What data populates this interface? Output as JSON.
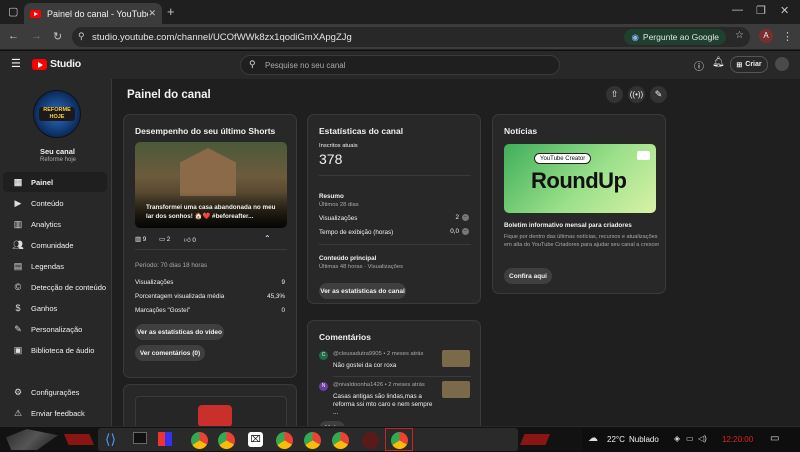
{
  "browser": {
    "tab_title": "Painel do canal - YouTube Studio",
    "url": "studio.youtube.com/channel/UCOfWWk8zx1qodiGmXApgZJg",
    "google_button": "Pergunte ao Google",
    "profile_letter": "A"
  },
  "header": {
    "logo_text": "Studio",
    "search_placeholder": "Pesquise no seu canal",
    "create_label": "Criar"
  },
  "sidebar": {
    "avatar_text": "REFORME HOJE",
    "channel_title": "Seu canal",
    "channel_name": "Reforme hoje",
    "items": [
      {
        "label": "Painel",
        "icon": "dashboard-icon"
      },
      {
        "label": "Conteúdo",
        "icon": "content-icon"
      },
      {
        "label": "Analytics",
        "icon": "analytics-icon"
      },
      {
        "label": "Comunidade",
        "icon": "community-icon"
      },
      {
        "label": "Legendas",
        "icon": "subtitles-icon"
      },
      {
        "label": "Detecção de conteúdo",
        "icon": "copyright-icon"
      },
      {
        "label": "Ganhos",
        "icon": "earn-icon"
      },
      {
        "label": "Personalização",
        "icon": "customization-icon"
      },
      {
        "label": "Biblioteca de áudio",
        "icon": "audio-library-icon"
      }
    ],
    "bottom_items": [
      {
        "label": "Configurações",
        "icon": "settings-icon"
      },
      {
        "label": "Enviar feedback",
        "icon": "feedback-icon"
      }
    ]
  },
  "page": {
    "title": "Painel do canal"
  },
  "shorts_card": {
    "title": "Desempenho do seu último Shorts",
    "video_title": "Transformei uma casa abandonada no meu lar dos sonhos! 🏠❤️ #beforeafter...",
    "views": "9",
    "comments": "2",
    "likes": "0",
    "dislikes": "0",
    "period": "Período: 70 dias 18 horas",
    "metrics": [
      {
        "label": "Visualizações",
        "value": "9"
      },
      {
        "label": "Porcentagem visualizada média",
        "value": "45,3%"
      },
      {
        "label": "Marcações \"Gostei\"",
        "value": "0"
      }
    ],
    "btn_stats": "Ver as estatísticas do vídeo",
    "btn_comments": "Ver comentários (0)"
  },
  "stats_card": {
    "title": "Estatísticas do canal",
    "subs_label": "Inscritos atuais",
    "subs_value": "378",
    "summary_title": "Resumo",
    "summary_period": "Últimos 28 dias",
    "rows": [
      {
        "label": "Visualizações",
        "value": "2"
      },
      {
        "label": "Tempo de exibição (horas)",
        "value": "0,0"
      }
    ],
    "top_title": "Conteúdo principal",
    "top_sub": "Últimas 48 horas · Visualizações",
    "btn": "Ver as estatísticas do canal"
  },
  "comments_card": {
    "title": "Comentários",
    "items": [
      {
        "initial": "C",
        "author": "@cleusadutra9905",
        "time": "• 2 meses atrás",
        "text": "Não gostei da cor roxa",
        "color": "#1f6b4a"
      },
      {
        "initial": "N",
        "author": "@nivaldoonha1426",
        "time": "• 2 meses atrás",
        "text": "Casas antigas são lindas,mas a reforma ssi mto caro e nem sempre ...",
        "color": "#6b3fa0"
      }
    ],
    "btn": "Mais"
  },
  "news_card": {
    "title": "Notícias",
    "banner_tag": "YouTube Creator",
    "banner_title": "RoundUp",
    "headline": "Boletim informativo mensal para criadores",
    "body": "Fique por dentro das últimas notícias, recursos e atualizações em alta do YouTube Criadores para ajudar seu canal a crescer",
    "btn": "Confira aqui"
  },
  "taskbar": {
    "temperature": "22°C",
    "weather": "Nublado",
    "time": "12:20:00"
  },
  "colors": {
    "accent": "#ff0000",
    "news_banner": "#2f9e4f"
  }
}
